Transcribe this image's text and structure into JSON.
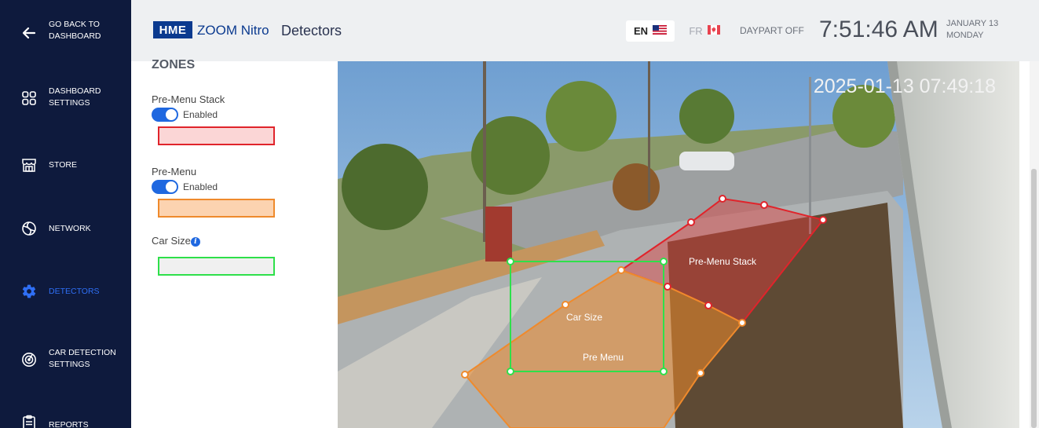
{
  "sidebar": {
    "items": [
      {
        "label_line1": "GO BACK TO",
        "label_line2": "DASHBOARD",
        "icon": "back-arrow-icon"
      },
      {
        "label_line1": "DASHBOARD",
        "label_line2": "SETTINGS",
        "icon": "dashboard-grid-icon"
      },
      {
        "label_line1": "STORE",
        "label_line2": "",
        "icon": "store-icon"
      },
      {
        "label_line1": "NETWORK",
        "label_line2": "",
        "icon": "network-icon"
      },
      {
        "label_line1": "DETECTORS",
        "label_line2": "",
        "icon": "gear-icon",
        "active": true
      },
      {
        "label_line1": "CAR DETECTION",
        "label_line2": "SETTINGS",
        "icon": "radar-icon"
      },
      {
        "label_line1": "REPORTS",
        "label_line2": "",
        "icon": "clipboard-icon"
      }
    ],
    "active_color": "#2f6ff5"
  },
  "header": {
    "brand_box": "HME",
    "brand_text": "ZOOM Nitro",
    "page_title": "Detectors",
    "lang_en": "EN",
    "lang_fr": "FR",
    "daypart": "DAYPART OFF",
    "time": "7:51:46 AM",
    "date_line1": "JANUARY 13",
    "date_line2": "MONDAY"
  },
  "zones": {
    "heading": "ZONES",
    "items": [
      {
        "name": "Pre-Menu Stack",
        "toggle_label": "Enabled",
        "enabled": true,
        "fill": "#fbd6d6",
        "border": "#e0242b"
      },
      {
        "name": "Pre-Menu",
        "toggle_label": "Enabled",
        "enabled": true,
        "fill": "#fcd3b0",
        "border": "#ef8a2c"
      },
      {
        "name": "Car Size",
        "fill": "#f0f0f0",
        "border": "#2ee04a"
      }
    ]
  },
  "camera": {
    "timestamp": "2025-01-13 07:49:18",
    "overlay_labels": {
      "pre_menu_stack": "Pre-Menu Stack",
      "car_size": "Car Size",
      "pre_menu": "Pre Menu"
    }
  },
  "colors": {
    "sidebar_bg": "#0e1a3d",
    "header_bg": "#eef0f2",
    "accent": "#1f68e0",
    "stack_zone": "#e0242b",
    "premenu_zone": "#ef8a2c",
    "carsize_zone": "#2ee04a"
  }
}
